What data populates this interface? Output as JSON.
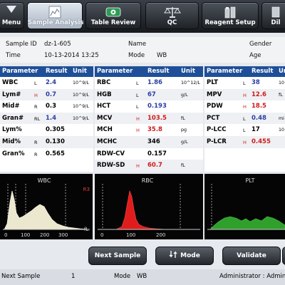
{
  "toolbar": {
    "menu": "Menu",
    "sample_analysis": "Sample Analysis",
    "table_review": "Table Review",
    "qc": "QC",
    "reagent_setup": "Reagent Setup",
    "dil": "Dil"
  },
  "info": {
    "sample_id_label": "Sample ID",
    "sample_id": "dz-1-605",
    "time_label": "Time",
    "time": "10-13-2014 13:25",
    "name_label": "Name",
    "mode_label": "Mode",
    "mode": "WB",
    "gender_label": "Gender",
    "age_label": "Age"
  },
  "headers": {
    "parameter": "Parameter",
    "result": "Result",
    "unit": "Unit"
  },
  "wbc_params": [
    {
      "name": "WBC",
      "flag": "L",
      "value": "2.4",
      "unit": "10^9/L",
      "color": "blue"
    },
    {
      "name": "Lym#",
      "flag": "H",
      "value": "0.7",
      "unit": "10^9/L",
      "color": "blue"
    },
    {
      "name": "Mid#",
      "flag": "R",
      "value": "0.3",
      "unit": "10^9/L",
      "color": "black"
    },
    {
      "name": "Gran#",
      "flag": "RL",
      "value": "1.4",
      "unit": "10^9/L",
      "color": "blue"
    },
    {
      "name": "Lym%",
      "flag": "",
      "value": "0.305",
      "unit": "",
      "color": "black"
    },
    {
      "name": "Mid%",
      "flag": "R",
      "value": "0.130",
      "unit": "",
      "color": "black"
    },
    {
      "name": "Gran%",
      "flag": "R",
      "value": "0.565",
      "unit": "",
      "color": "black"
    }
  ],
  "rbc_params": [
    {
      "name": "RBC",
      "flag": "L",
      "value": "1.86",
      "unit": "10^12/L",
      "color": "blue"
    },
    {
      "name": "HGB",
      "flag": "L",
      "value": "67",
      "unit": "g/L",
      "color": "blue"
    },
    {
      "name": "HCT",
      "flag": "L",
      "value": "0.193",
      "unit": "",
      "color": "blue"
    },
    {
      "name": "MCV",
      "flag": "H",
      "value": "103.5",
      "unit": "fL",
      "color": "red"
    },
    {
      "name": "MCH",
      "flag": "H",
      "value": "35.8",
      "unit": "pg",
      "color": "red"
    },
    {
      "name": "MCHC",
      "flag": "",
      "value": "346",
      "unit": "g/L",
      "color": "black"
    },
    {
      "name": "RDW-CV",
      "flag": "",
      "value": "0.157",
      "unit": "",
      "color": "black"
    },
    {
      "name": "RDW-SD",
      "flag": "H",
      "value": "60.7",
      "unit": "fL",
      "color": "red"
    }
  ],
  "plt_params": [
    {
      "name": "PLT",
      "flag": "L",
      "value": "38",
      "unit": "10",
      "color": "blue"
    },
    {
      "name": "MPV",
      "flag": "H",
      "value": "12.6",
      "unit": "fL",
      "color": "red"
    },
    {
      "name": "PDW",
      "flag": "H",
      "value": "18.5",
      "unit": "",
      "color": "red"
    },
    {
      "name": "PCT",
      "flag": "L",
      "value": "0.48",
      "unit": "mi",
      "color": "blue"
    },
    {
      "name": "P-LCC",
      "flag": "L",
      "value": "17",
      "unit": "10",
      "color": "black"
    },
    {
      "name": "P-LCR",
      "flag": "H",
      "value": "0.455",
      "unit": "",
      "color": "red"
    }
  ],
  "histograms": {
    "wbc": {
      "title": "WBC",
      "flag": "R3",
      "unit": "fL",
      "ticks": [
        "0",
        "100",
        "200",
        "300"
      ]
    },
    "rbc": {
      "title": "RBC",
      "ticks": [
        "0",
        "100",
        "200"
      ]
    },
    "plt": {
      "title": "PLT"
    }
  },
  "actions": {
    "next_sample": "Next Sample",
    "mode": "Mode",
    "validate": "Validate"
  },
  "status": {
    "next_sample_label": "Next Sample",
    "next_sample_value": "1",
    "mode_label": "Mode",
    "mode_value": "WB",
    "user": "Administrator : Admin"
  },
  "colors": {
    "header_blue": "#1e4f98",
    "high_red": "#d01a1a",
    "low_blue": "#2a3ea6",
    "wbc_curve": "#ece8cf",
    "rbc_fill": "#e11c1c",
    "plt_fill": "#2fa02b"
  }
}
